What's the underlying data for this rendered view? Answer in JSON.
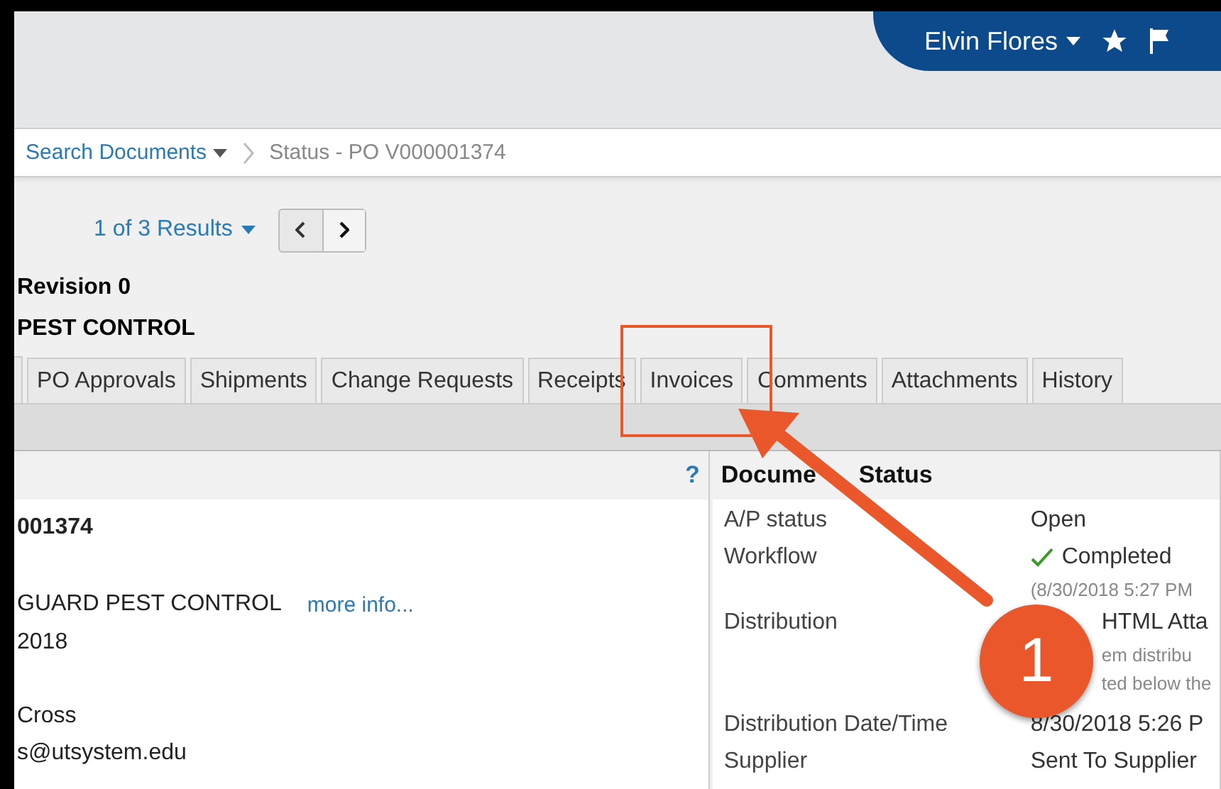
{
  "user_menu": {
    "name": "Elvin Flores"
  },
  "breadcrumb": {
    "link": "Search Documents",
    "current": "Status - PO V000001374"
  },
  "results": {
    "label": "1 of 3 Results"
  },
  "heading": {
    "revision": "Revision 0",
    "title": "PEST CONTROL"
  },
  "tabs": [
    {
      "label": "PO Approvals"
    },
    {
      "label": "Shipments"
    },
    {
      "label": "Change Requests"
    },
    {
      "label": "Receipts"
    },
    {
      "label": "Invoices"
    },
    {
      "label": "Comments"
    },
    {
      "label": "Attachments"
    },
    {
      "label": "History"
    }
  ],
  "summary_panel": {
    "help": "?",
    "lines": [
      {
        "kind": "bold",
        "text": "001374"
      },
      {
        "kind": "gap"
      },
      {
        "kind": "link",
        "text": "GUARD PEST CONTROL",
        "link": "more info..."
      },
      {
        "kind": "plain",
        "text": "2018"
      },
      {
        "kind": "gap"
      },
      {
        "kind": "plain",
        "text": "Cross"
      },
      {
        "kind": "plain",
        "text": "s@utsystem.edu"
      }
    ]
  },
  "status_panel": {
    "title": [
      "Docume",
      "Status"
    ],
    "rows": [
      {
        "label": "A/P status",
        "lines": [
          {
            "kind": "plain",
            "text": "Open"
          }
        ]
      },
      {
        "label": "Workflow",
        "lines": [
          {
            "kind": "check",
            "text": "Completed"
          },
          {
            "kind": "note",
            "text": "(8/30/2018 5:27 PM"
          }
        ]
      },
      {
        "label": "Distribution",
        "lines": [
          {
            "kind": "covered",
            "text": "HTML Atta"
          },
          {
            "kind": "covered-note",
            "text": "em distribu"
          },
          {
            "kind": "covered-note",
            "text": "ted below the"
          }
        ]
      },
      {
        "label": "Distribution Date/Time",
        "lines": [
          {
            "kind": "plain",
            "text": "8/30/2018 5:26 P"
          }
        ]
      },
      {
        "label": "Supplier",
        "lines": [
          {
            "kind": "plain",
            "text": "Sent To Supplier"
          }
        ]
      }
    ]
  },
  "annotation": {
    "step": "1"
  }
}
